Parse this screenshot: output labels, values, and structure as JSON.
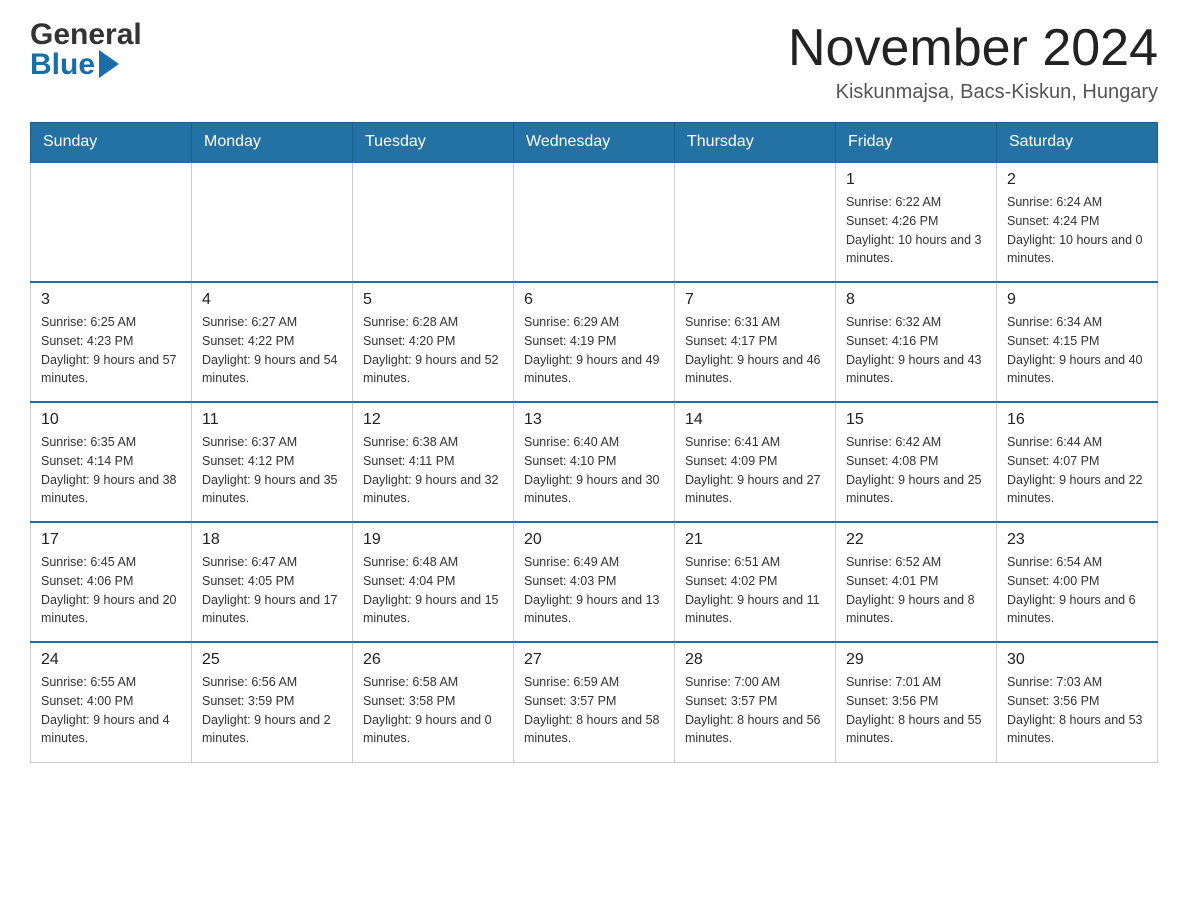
{
  "header": {
    "logo_general": "General",
    "logo_blue": "Blue",
    "title": "November 2024",
    "subtitle": "Kiskunmajsa, Bacs-Kiskun, Hungary"
  },
  "days_of_week": [
    "Sunday",
    "Monday",
    "Tuesday",
    "Wednesday",
    "Thursday",
    "Friday",
    "Saturday"
  ],
  "weeks": [
    {
      "days": [
        {
          "number": "",
          "info": ""
        },
        {
          "number": "",
          "info": ""
        },
        {
          "number": "",
          "info": ""
        },
        {
          "number": "",
          "info": ""
        },
        {
          "number": "",
          "info": ""
        },
        {
          "number": "1",
          "info": "Sunrise: 6:22 AM\nSunset: 4:26 PM\nDaylight: 10 hours and 3 minutes."
        },
        {
          "number": "2",
          "info": "Sunrise: 6:24 AM\nSunset: 4:24 PM\nDaylight: 10 hours and 0 minutes."
        }
      ]
    },
    {
      "days": [
        {
          "number": "3",
          "info": "Sunrise: 6:25 AM\nSunset: 4:23 PM\nDaylight: 9 hours and 57 minutes."
        },
        {
          "number": "4",
          "info": "Sunrise: 6:27 AM\nSunset: 4:22 PM\nDaylight: 9 hours and 54 minutes."
        },
        {
          "number": "5",
          "info": "Sunrise: 6:28 AM\nSunset: 4:20 PM\nDaylight: 9 hours and 52 minutes."
        },
        {
          "number": "6",
          "info": "Sunrise: 6:29 AM\nSunset: 4:19 PM\nDaylight: 9 hours and 49 minutes."
        },
        {
          "number": "7",
          "info": "Sunrise: 6:31 AM\nSunset: 4:17 PM\nDaylight: 9 hours and 46 minutes."
        },
        {
          "number": "8",
          "info": "Sunrise: 6:32 AM\nSunset: 4:16 PM\nDaylight: 9 hours and 43 minutes."
        },
        {
          "number": "9",
          "info": "Sunrise: 6:34 AM\nSunset: 4:15 PM\nDaylight: 9 hours and 40 minutes."
        }
      ]
    },
    {
      "days": [
        {
          "number": "10",
          "info": "Sunrise: 6:35 AM\nSunset: 4:14 PM\nDaylight: 9 hours and 38 minutes."
        },
        {
          "number": "11",
          "info": "Sunrise: 6:37 AM\nSunset: 4:12 PM\nDaylight: 9 hours and 35 minutes."
        },
        {
          "number": "12",
          "info": "Sunrise: 6:38 AM\nSunset: 4:11 PM\nDaylight: 9 hours and 32 minutes."
        },
        {
          "number": "13",
          "info": "Sunrise: 6:40 AM\nSunset: 4:10 PM\nDaylight: 9 hours and 30 minutes."
        },
        {
          "number": "14",
          "info": "Sunrise: 6:41 AM\nSunset: 4:09 PM\nDaylight: 9 hours and 27 minutes."
        },
        {
          "number": "15",
          "info": "Sunrise: 6:42 AM\nSunset: 4:08 PM\nDaylight: 9 hours and 25 minutes."
        },
        {
          "number": "16",
          "info": "Sunrise: 6:44 AM\nSunset: 4:07 PM\nDaylight: 9 hours and 22 minutes."
        }
      ]
    },
    {
      "days": [
        {
          "number": "17",
          "info": "Sunrise: 6:45 AM\nSunset: 4:06 PM\nDaylight: 9 hours and 20 minutes."
        },
        {
          "number": "18",
          "info": "Sunrise: 6:47 AM\nSunset: 4:05 PM\nDaylight: 9 hours and 17 minutes."
        },
        {
          "number": "19",
          "info": "Sunrise: 6:48 AM\nSunset: 4:04 PM\nDaylight: 9 hours and 15 minutes."
        },
        {
          "number": "20",
          "info": "Sunrise: 6:49 AM\nSunset: 4:03 PM\nDaylight: 9 hours and 13 minutes."
        },
        {
          "number": "21",
          "info": "Sunrise: 6:51 AM\nSunset: 4:02 PM\nDaylight: 9 hours and 11 minutes."
        },
        {
          "number": "22",
          "info": "Sunrise: 6:52 AM\nSunset: 4:01 PM\nDaylight: 9 hours and 8 minutes."
        },
        {
          "number": "23",
          "info": "Sunrise: 6:54 AM\nSunset: 4:00 PM\nDaylight: 9 hours and 6 minutes."
        }
      ]
    },
    {
      "days": [
        {
          "number": "24",
          "info": "Sunrise: 6:55 AM\nSunset: 4:00 PM\nDaylight: 9 hours and 4 minutes."
        },
        {
          "number": "25",
          "info": "Sunrise: 6:56 AM\nSunset: 3:59 PM\nDaylight: 9 hours and 2 minutes."
        },
        {
          "number": "26",
          "info": "Sunrise: 6:58 AM\nSunset: 3:58 PM\nDaylight: 9 hours and 0 minutes."
        },
        {
          "number": "27",
          "info": "Sunrise: 6:59 AM\nSunset: 3:57 PM\nDaylight: 8 hours and 58 minutes."
        },
        {
          "number": "28",
          "info": "Sunrise: 7:00 AM\nSunset: 3:57 PM\nDaylight: 8 hours and 56 minutes."
        },
        {
          "number": "29",
          "info": "Sunrise: 7:01 AM\nSunset: 3:56 PM\nDaylight: 8 hours and 55 minutes."
        },
        {
          "number": "30",
          "info": "Sunrise: 7:03 AM\nSunset: 3:56 PM\nDaylight: 8 hours and 53 minutes."
        }
      ]
    }
  ]
}
